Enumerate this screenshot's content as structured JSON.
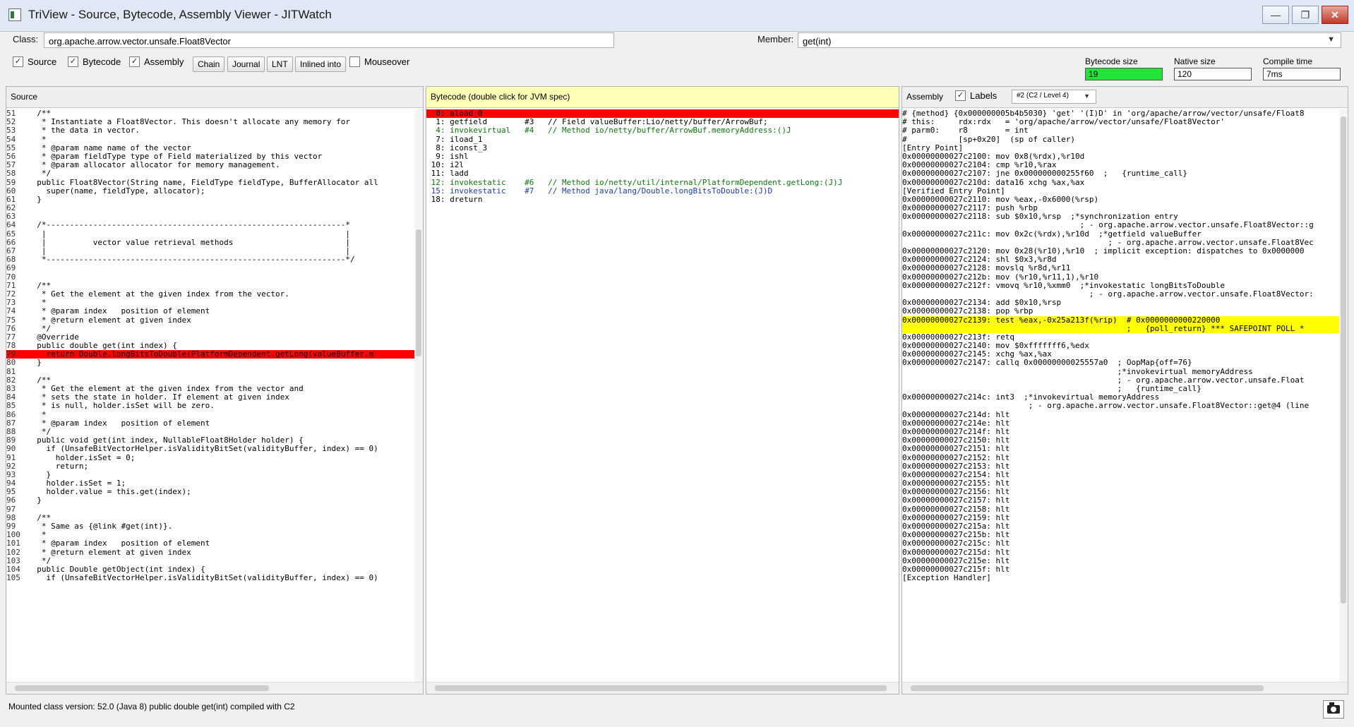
{
  "window": {
    "title": "TriView - Source, Bytecode, Assembly Viewer - JITWatch"
  },
  "toolbar": {
    "class_label": "Class:",
    "class_value": "org.apache.arrow.vector.unsafe.Float8Vector",
    "member_label": "Member:",
    "member_value": "get(int)",
    "checkboxes": {
      "source": "Source",
      "bytecode": "Bytecode",
      "assembly": "Assembly",
      "mouseover": "Mouseover"
    },
    "buttons": {
      "chain": "Chain",
      "journal": "Journal",
      "lnt": "LNT",
      "inlined": "Inlined into"
    },
    "stats": {
      "bytecode_size_label": "Bytecode size",
      "bytecode_size": "19",
      "native_size_label": "Native size",
      "native_size": "120",
      "compile_time_label": "Compile time",
      "compile_time": "7ms"
    }
  },
  "source_panel": {
    "title": "Source",
    "lines": [
      {
        "n": "51",
        "t": "  /**"
      },
      {
        "n": "52",
        "t": "   * Instantiate a Float8Vector. This doesn't allocate any memory for"
      },
      {
        "n": "53",
        "t": "   * the data in vector."
      },
      {
        "n": "54",
        "t": "   *"
      },
      {
        "n": "55",
        "t": "   * @param name name of the vector"
      },
      {
        "n": "56",
        "t": "   * @param fieldType type of Field materialized by this vector"
      },
      {
        "n": "57",
        "t": "   * @param allocator allocator for memory management."
      },
      {
        "n": "58",
        "t": "   */"
      },
      {
        "n": "59",
        "t": "  public Float8Vector(String name, FieldType fieldType, BufferAllocator all"
      },
      {
        "n": "60",
        "t": "    super(name, fieldType, allocator);"
      },
      {
        "n": "61",
        "t": "  }"
      },
      {
        "n": "62",
        "t": ""
      },
      {
        "n": "63",
        "t": ""
      },
      {
        "n": "64",
        "t": "  /*----------------------------------------------------------------*"
      },
      {
        "n": "65",
        "t": "   |                                                                |"
      },
      {
        "n": "66",
        "t": "   |          vector value retrieval methods                        |"
      },
      {
        "n": "67",
        "t": "   |                                                                |"
      },
      {
        "n": "68",
        "t": "   *----------------------------------------------------------------*/"
      },
      {
        "n": "69",
        "t": ""
      },
      {
        "n": "70",
        "t": ""
      },
      {
        "n": "71",
        "t": "  /**"
      },
      {
        "n": "72",
        "t": "   * Get the element at the given index from the vector."
      },
      {
        "n": "73",
        "t": "   *"
      },
      {
        "n": "74",
        "t": "   * @param index   position of element"
      },
      {
        "n": "75",
        "t": "   * @return element at given index"
      },
      {
        "n": "76",
        "t": "   */"
      },
      {
        "n": "77",
        "t": "  @Override"
      },
      {
        "n": "78",
        "t": "  public double get(int index) {"
      },
      {
        "n": "79",
        "t": "    return Double.longBitsToDouble(PlatformDependent.getLong(valueBuffer.m"
      },
      {
        "n": "80",
        "t": "  }"
      },
      {
        "n": "81",
        "t": ""
      },
      {
        "n": "82",
        "t": "  /**"
      },
      {
        "n": "83",
        "t": "   * Get the element at the given index from the vector and"
      },
      {
        "n": "84",
        "t": "   * sets the state in holder. If element at given index"
      },
      {
        "n": "85",
        "t": "   * is null, holder.isSet will be zero."
      },
      {
        "n": "86",
        "t": "   *"
      },
      {
        "n": "87",
        "t": "   * @param index   position of element"
      },
      {
        "n": "88",
        "t": "   */"
      },
      {
        "n": "89",
        "t": "  public void get(int index, NullableFloat8Holder holder) {"
      },
      {
        "n": "90",
        "t": "    if (UnsafeBitVectorHelper.isValidityBitSet(validityBuffer, index) == 0)"
      },
      {
        "n": "91",
        "t": "      holder.isSet = 0;"
      },
      {
        "n": "92",
        "t": "      return;"
      },
      {
        "n": "93",
        "t": "    }"
      },
      {
        "n": "94",
        "t": "    holder.isSet = 1;"
      },
      {
        "n": "95",
        "t": "    holder.value = this.get(index);"
      },
      {
        "n": "96",
        "t": "  }"
      },
      {
        "n": "97",
        "t": ""
      },
      {
        "n": "98",
        "t": "  /**"
      },
      {
        "n": "99",
        "t": "   * Same as {@link #get(int)}."
      },
      {
        "n": "100",
        "t": "   *"
      },
      {
        "n": "101",
        "t": "   * @param index   position of element"
      },
      {
        "n": "102",
        "t": "   * @return element at given index"
      },
      {
        "n": "103",
        "t": "   */"
      },
      {
        "n": "104",
        "t": "  public Double getObject(int index) {"
      },
      {
        "n": "105",
        "t": "    if (UnsafeBitVectorHelper.isValidityBitSet(validityBuffer, index) == 0)"
      }
    ],
    "selected_line": "79"
  },
  "bytecode_panel": {
    "title": "Bytecode (double click for JVM spec)",
    "lines": [
      {
        "t": " 0: aload_0",
        "c": "sel"
      },
      {
        "t": " 1: getfield        #3   // Field valueBuffer:Lio/netty/buffer/ArrowBuf;",
        "c": ""
      },
      {
        "t": " 4: invokevirtual   #4   // Method io/netty/buffer/ArrowBuf.memoryAddress:()J",
        "c": "grn"
      },
      {
        "t": " 7: iload_1",
        "c": ""
      },
      {
        "t": " 8: iconst_3",
        "c": ""
      },
      {
        "t": " 9: ishl",
        "c": ""
      },
      {
        "t": "10: i2l",
        "c": ""
      },
      {
        "t": "11: ladd",
        "c": ""
      },
      {
        "t": "12: invokestatic    #6   // Method io/netty/util/internal/PlatformDependent.getLong:(J)J",
        "c": "grn"
      },
      {
        "t": "15: invokestatic    #7   // Method java/lang/Double.longBitsToDouble:(J)D",
        "c": "blu"
      },
      {
        "t": "18: dreturn",
        "c": ""
      }
    ]
  },
  "assembly_panel": {
    "title": "Assembly",
    "labels_label": "Labels",
    "compiler": "#2 (C2 / Level 4)",
    "lines": [
      {
        "t": "# {method} {0x000000005b4b5030} 'get' '(I)D' in 'org/apache/arrow/vector/unsafe/Float8",
        "c": ""
      },
      {
        "t": "# this:     rdx:rdx   = 'org/apache/arrow/vector/unsafe/Float8Vector'",
        "c": ""
      },
      {
        "t": "# parm0:    r8        = int",
        "c": ""
      },
      {
        "t": "#           [sp+0x20]  (sp of caller)",
        "c": ""
      },
      {
        "t": "[Entry Point]",
        "c": ""
      },
      {
        "t": "0x00000000027c2100: mov 0x8(%rdx),%r10d",
        "c": ""
      },
      {
        "t": "0x00000000027c2104: cmp %r10,%rax",
        "c": ""
      },
      {
        "t": "0x00000000027c2107: jne 0x000000000255f60  ;   {runtime_call}",
        "c": ""
      },
      {
        "t": "0x00000000027c210d: data16 xchg %ax,%ax",
        "c": ""
      },
      {
        "t": "[Verified Entry Point]",
        "c": ""
      },
      {
        "t": "0x00000000027c2110: mov %eax,-0x6000(%rsp)",
        "c": ""
      },
      {
        "t": "0x00000000027c2117: push %rbp",
        "c": ""
      },
      {
        "t": "0x00000000027c2118: sub $0x10,%rsp  ;*synchronization entry",
        "c": ""
      },
      {
        "t": "                                      ; - org.apache.arrow.vector.unsafe.Float8Vector::g",
        "c": ""
      },
      {
        "t": "0x00000000027c211c: mov 0x2c(%rdx),%r10d  ;*getfield valueBuffer",
        "c": ""
      },
      {
        "t": "                                            ; - org.apache.arrow.vector.unsafe.Float8Vec",
        "c": ""
      },
      {
        "t": "0x00000000027c2120: mov 0x28(%r10),%r10  ; implicit exception: dispatches to 0x0000000",
        "c": ""
      },
      {
        "t": "0x00000000027c2124: shl $0x3,%r8d",
        "c": ""
      },
      {
        "t": "0x00000000027c2128: movslq %r8d,%r11",
        "c": ""
      },
      {
        "t": "0x00000000027c212b: mov (%r10,%r11,1),%r10",
        "c": ""
      },
      {
        "t": "0x00000000027c212f: vmovq %r10,%xmm0  ;*invokestatic longBitsToDouble",
        "c": ""
      },
      {
        "t": "                                        ; - org.apache.arrow.vector.unsafe.Float8Vector:",
        "c": ""
      },
      {
        "t": "0x00000000027c2134: add $0x10,%rsp",
        "c": ""
      },
      {
        "t": "0x00000000027c2138: pop %rbp",
        "c": ""
      },
      {
        "t": "0x00000000027c2139: test %eax,-0x25a213f(%rip)  # 0x0000000000220000",
        "c": "hl"
      },
      {
        "t": "                                                ;   {poll_return} *** SAFEPOINT POLL *",
        "c": "hl"
      },
      {
        "t": "0x00000000027c213f: retq",
        "c": ""
      },
      {
        "t": "0x00000000027c2140: mov $0xfffffff6,%edx",
        "c": ""
      },
      {
        "t": "0x00000000027c2145: xchg %ax,%ax",
        "c": ""
      },
      {
        "t": "0x00000000027c2147: callq 0x00000000025557a0  ; OopMap{off=76}",
        "c": ""
      },
      {
        "t": "                                              ;*invokevirtual memoryAddress",
        "c": ""
      },
      {
        "t": "                                              ; - org.apache.arrow.vector.unsafe.Float",
        "c": ""
      },
      {
        "t": "                                              ;   {runtime_call}",
        "c": ""
      },
      {
        "t": "0x00000000027c214c: int3  ;*invokevirtual memoryAddress",
        "c": ""
      },
      {
        "t": "                           ; - org.apache.arrow.vector.unsafe.Float8Vector::get@4 (line",
        "c": ""
      },
      {
        "t": "0x00000000027c214d: hlt",
        "c": ""
      },
      {
        "t": "0x00000000027c214e: hlt",
        "c": ""
      },
      {
        "t": "0x00000000027c214f: hlt",
        "c": ""
      },
      {
        "t": "0x00000000027c2150: hlt",
        "c": ""
      },
      {
        "t": "0x00000000027c2151: hlt",
        "c": ""
      },
      {
        "t": "0x00000000027c2152: hlt",
        "c": ""
      },
      {
        "t": "0x00000000027c2153: hlt",
        "c": ""
      },
      {
        "t": "0x00000000027c2154: hlt",
        "c": ""
      },
      {
        "t": "0x00000000027c2155: hlt",
        "c": ""
      },
      {
        "t": "0x00000000027c2156: hlt",
        "c": ""
      },
      {
        "t": "0x00000000027c2157: hlt",
        "c": ""
      },
      {
        "t": "0x00000000027c2158: hlt",
        "c": ""
      },
      {
        "t": "0x00000000027c2159: hlt",
        "c": ""
      },
      {
        "t": "0x00000000027c215a: hlt",
        "c": ""
      },
      {
        "t": "0x00000000027c215b: hlt",
        "c": ""
      },
      {
        "t": "0x00000000027c215c: hlt",
        "c": ""
      },
      {
        "t": "0x00000000027c215d: hlt",
        "c": ""
      },
      {
        "t": "0x00000000027c215e: hlt",
        "c": ""
      },
      {
        "t": "0x00000000027c215f: hlt",
        "c": ""
      },
      {
        "t": "[Exception Handler]",
        "c": ""
      }
    ]
  },
  "status": {
    "text": "Mounted class version: 52.0 (Java 8) public double get(int) compiled with C2"
  }
}
